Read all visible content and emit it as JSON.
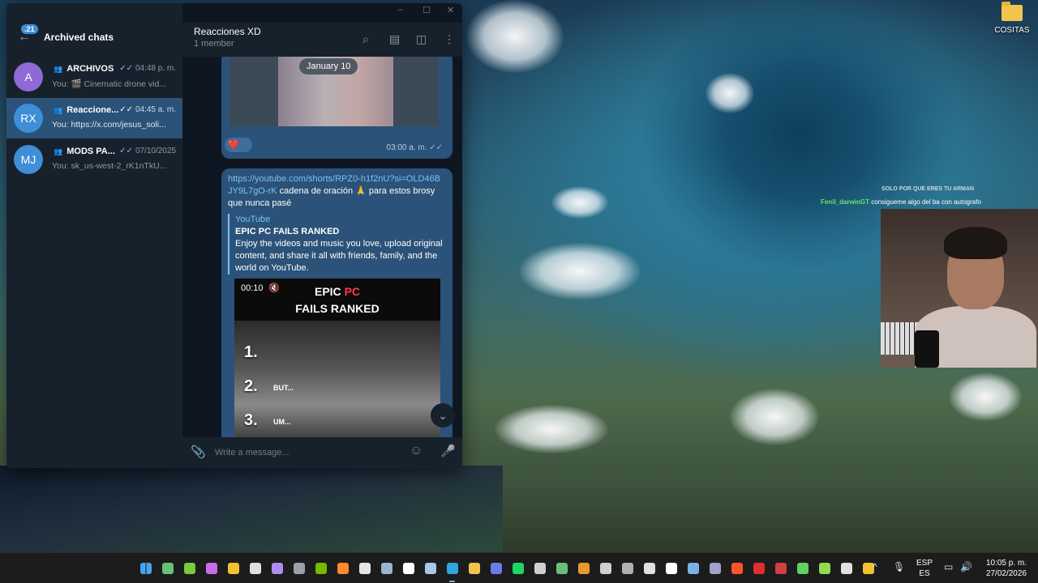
{
  "desktop": {
    "icon_label": "COSITAS",
    "stream_overlay": {
      "header": "SOLO POR QUE ERES TU ARMAN",
      "chat_user": "Fenil_darwinGT",
      "chat_message": "consigueme algo del ba con autografo"
    }
  },
  "telegram": {
    "window_controls": {
      "minimize": "–",
      "maximize": "☐",
      "close": "✕"
    },
    "sidebar": {
      "unread_badge": ".21",
      "title": "Archived chats",
      "chats": [
        {
          "initials": "A",
          "avatar_color": "#8e6ad6",
          "name": "ARCHIVOS",
          "time": "04:48 p. m.",
          "preview": "You: 🎬 Cinematic drone vid..."
        },
        {
          "initials": "RX",
          "avatar_color": "#3e8ed8",
          "name": "Reaccione...",
          "time": "04:45 a. m.",
          "preview": "You: https://x.com/jesus_soli..."
        },
        {
          "initials": "MJ",
          "avatar_color": "#3e8ed8",
          "name": "MODS PA...",
          "time": "07/10/2025",
          "preview": "You: sk_us-west-2_rK1nTkU..."
        }
      ]
    },
    "chat": {
      "name": "Reacciones XD",
      "status": "1 member",
      "date_pill": "January 10",
      "message1": {
        "reaction": "❤️",
        "time": "03:00 a. m."
      },
      "message2": {
        "link": "https://youtube.com/shorts/RPZ0-h1f2nU?si=OLD46BJY9L7gO-rK",
        "text": " cadena de oración 🙏 para estos brosy que nunca pasé",
        "preview_site": "YouTube",
        "preview_title": "EPIC PC FAILS RANKED",
        "preview_desc": "Enjoy the videos and music you love, upload original content, and share it all with friends, family, and the world on YouTube.",
        "video": {
          "timer": "00:10",
          "title_word1": "EPIC",
          "title_word2": "PC",
          "title_word3": "FAILS RANKED",
          "ranks": [
            "1.",
            "2.",
            "3."
          ],
          "rank2_sub": "BUT...",
          "rank3_sub": "UM..."
        }
      },
      "composer_placeholder": "Write a message..."
    }
  },
  "taskbar": {
    "apps": [
      {
        "name": "start-icon",
        "color": "#4aa3f0"
      },
      {
        "name": "app-icon",
        "color": "#66c07a"
      },
      {
        "name": "xbox-icon",
        "color": "#7ac943"
      },
      {
        "name": "copilot-icon",
        "color": "#c86de8"
      },
      {
        "name": "chrome-icon",
        "color": "#f2c230"
      },
      {
        "name": "browser-icon",
        "color": "#e0e0e0"
      },
      {
        "name": "app2-icon",
        "color": "#b08bf0"
      },
      {
        "name": "ide-icon",
        "color": "#9aa0a6"
      },
      {
        "name": "nvidia-icon",
        "color": "#76b900"
      },
      {
        "name": "firefox-icon",
        "color": "#ff8a2b"
      },
      {
        "name": "capcut-icon",
        "color": "#e6e6e6"
      },
      {
        "name": "settings-icon",
        "color": "#9ab4d0"
      },
      {
        "name": "epic-icon",
        "color": "#ffffff"
      },
      {
        "name": "steam-icon",
        "color": "#a8c6e6"
      },
      {
        "name": "telegram-icon",
        "color": "#2ea6e0"
      },
      {
        "name": "explorer-icon",
        "color": "#f3c44c"
      },
      {
        "name": "discord-icon",
        "color": "#6c7be8"
      },
      {
        "name": "spotify-icon",
        "color": "#1ed760"
      },
      {
        "name": "share-icon",
        "color": "#d0d0d0"
      },
      {
        "name": "app3-icon",
        "color": "#66c07a"
      },
      {
        "name": "app4-icon",
        "color": "#e69a2e"
      },
      {
        "name": "obs-icon",
        "color": "#d0d0d0"
      },
      {
        "name": "camera-icon",
        "color": "#b0b0b0"
      },
      {
        "name": "github-icon",
        "color": "#e0e0e0"
      },
      {
        "name": "capcut2-icon",
        "color": "#ffffff"
      },
      {
        "name": "terminal-icon",
        "color": "#7ab0e8"
      },
      {
        "name": "app5-icon",
        "color": "#a0a0c8"
      },
      {
        "name": "brave-icon",
        "color": "#fb542b"
      },
      {
        "name": "app6-icon",
        "color": "#e02e2e"
      },
      {
        "name": "app7-icon",
        "color": "#d04040"
      },
      {
        "name": "play-icon",
        "color": "#5fd35f"
      },
      {
        "name": "app8-icon",
        "color": "#8fdc4f"
      },
      {
        "name": "app9-icon",
        "color": "#e0e0e0"
      },
      {
        "name": "chrome2-icon",
        "color": "#f2c230"
      }
    ],
    "tray": {
      "chevron": "^",
      "mic": "🎙",
      "lang_top": "ESP",
      "lang_bottom": "ES",
      "time": "10:05 p. m.",
      "date": "27/02/2026"
    }
  }
}
